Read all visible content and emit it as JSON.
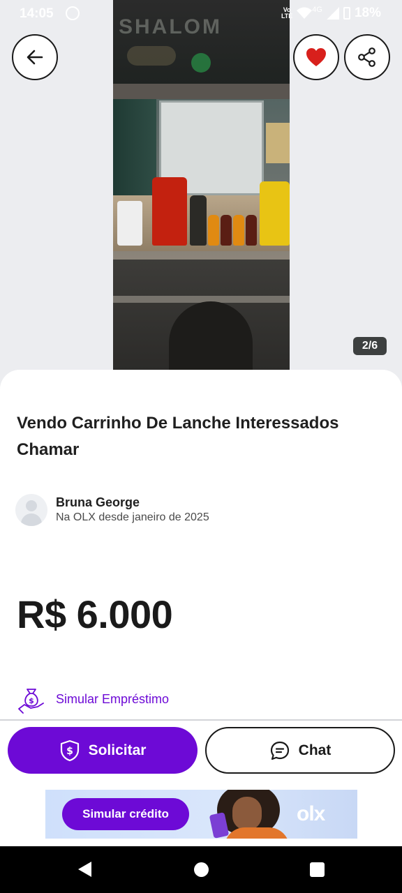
{
  "status_bar": {
    "time": "14:05",
    "volte_line1": "Vo",
    "volte_line2": "LTE",
    "network": "4G",
    "battery": "18%"
  },
  "gallery": {
    "counter": "2/6",
    "photo_sign_text": "SHALOM",
    "current_index": 2,
    "total": 6
  },
  "actions": {
    "back_icon": "arrow-left-icon",
    "favorite_icon": "heart-icon",
    "share_icon": "share-icon",
    "favorited": true
  },
  "listing": {
    "title": "Vendo Carrinho De Lanche Interessados Chamar",
    "price": "R$ 6.000"
  },
  "seller": {
    "name": "Bruna George",
    "since": "Na OLX desde janeiro de 2025"
  },
  "loan": {
    "label": "Simular Empréstimo",
    "icon": "money-bag-hand-icon"
  },
  "buttons": {
    "solicitar_label": "Solicitar",
    "solicitar_icon": "shield-dollar-icon",
    "chat_label": "Chat",
    "chat_icon": "chat-bubble-icon"
  },
  "banner": {
    "cta_label": "Simular crédito",
    "logo": "olx"
  },
  "colors": {
    "accent": "#6d0ad6",
    "favorite": "#d8201c",
    "text": "#1a1a1a"
  }
}
